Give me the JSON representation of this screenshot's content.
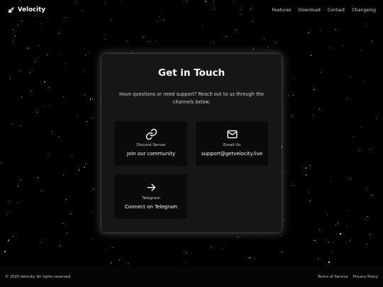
{
  "navbar": {
    "brand": "Velocity",
    "links": [
      "Features",
      "Download",
      "Contact",
      "Changelog"
    ]
  },
  "contact": {
    "title": "Get in Touch",
    "subtitle": "Have questions or need support? Reach out to us through the channels below.",
    "channels": [
      {
        "label": "Discord Server",
        "value": "Join our community",
        "icon": "link-icon"
      },
      {
        "label": "Email Us",
        "value": "support@getvelocity.live",
        "icon": "envelope-icon"
      },
      {
        "label": "Telegram",
        "value": "Connect on Telegram",
        "icon": "arrow-right-icon"
      }
    ]
  },
  "footer": {
    "copyright": "© 2025 Velocity. All rights reserved.",
    "links": [
      "Terms of Service",
      "Privacy Policy"
    ]
  },
  "colors": {
    "background": "#000000",
    "card": "#161616",
    "tile": "#0a0a0a",
    "text": "#ffffff"
  }
}
